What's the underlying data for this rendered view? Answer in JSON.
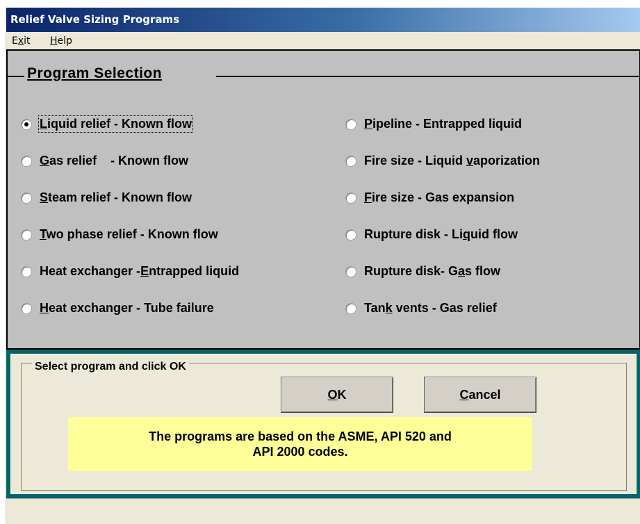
{
  "window": {
    "title": "Relief Valve Sizing Programs"
  },
  "menu": {
    "exit": {
      "pre": "E",
      "ul": "x",
      "post": "it"
    },
    "help": {
      "pre": "",
      "ul": "H",
      "post": "elp"
    }
  },
  "program_selection": {
    "title": "Program  Selection",
    "left_options": [
      {
        "pre": "",
        "ul": "L",
        "post": "iquid relief - Known flow",
        "checked": true
      },
      {
        "pre": "",
        "ul": "G",
        "post": "as relief    - Known flow",
        "checked": false
      },
      {
        "pre": "",
        "ul": "S",
        "post": "team relief - Known flow",
        "checked": false
      },
      {
        "pre": "",
        "ul": "T",
        "post": "wo phase relief - Known flow",
        "checked": false
      },
      {
        "pre": "Heat exchanger -",
        "ul": "E",
        "post": "ntrapped liquid",
        "checked": false
      },
      {
        "pre": "",
        "ul": "H",
        "post": "eat exchanger - Tube failure",
        "checked": false
      }
    ],
    "right_options": [
      {
        "pre": "",
        "ul": "P",
        "post": "ipeline - Entrapped liquid",
        "checked": false
      },
      {
        "pre": "Fire size - Liquid ",
        "ul": "v",
        "post": "aporization",
        "checked": false
      },
      {
        "pre": "",
        "ul": "F",
        "post": "ire size - Gas expansion",
        "checked": false
      },
      {
        "pre": "Rupture disk - Li",
        "ul": "q",
        "post": "uid flow",
        "checked": false
      },
      {
        "pre": "Rupture disk- G",
        "ul": "a",
        "post": "s flow",
        "checked": false
      },
      {
        "pre": "Tan",
        "ul": "k",
        "post": " vents - Gas relief",
        "checked": false
      }
    ]
  },
  "action": {
    "label": "Select program and click OK",
    "ok": {
      "pre": "",
      "ul": "O",
      "post": "K"
    },
    "cancel": {
      "pre": "",
      "ul": "C",
      "post": "ancel"
    },
    "note_line1": "The programs are based on the ASME, API 520 and",
    "note_line2": "API 2000 codes."
  },
  "colors": {
    "panel_bg": "#c0c0c0",
    "bottom_border": "#006666",
    "note_bg": "#ffff99"
  }
}
